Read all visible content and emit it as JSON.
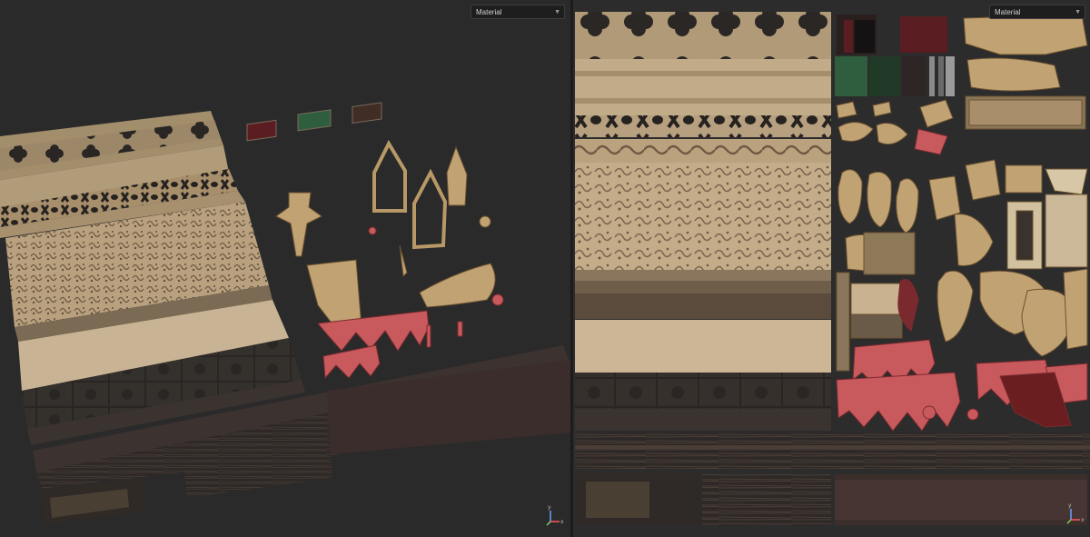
{
  "viewport_3d": {
    "shading_dropdown": {
      "selected": "Material"
    },
    "gizmo_icon": "axis-gizmo-icon"
  },
  "viewport_uv": {
    "shading_dropdown": {
      "selected": "Material"
    },
    "gizmo_icon": "axis-gizmo-icon"
  },
  "colors": {
    "background": "#2a2a2a",
    "stone": "#c9b08c",
    "gold": "#c1a273",
    "dark_wood": "#3a302c",
    "red_cloth": "#c85a5e",
    "green_swatch": "#2f5e3e",
    "wine_swatch": "#5a1e22"
  },
  "icons": [
    "chevron-down-icon",
    "axis-gizmo-icon"
  ]
}
